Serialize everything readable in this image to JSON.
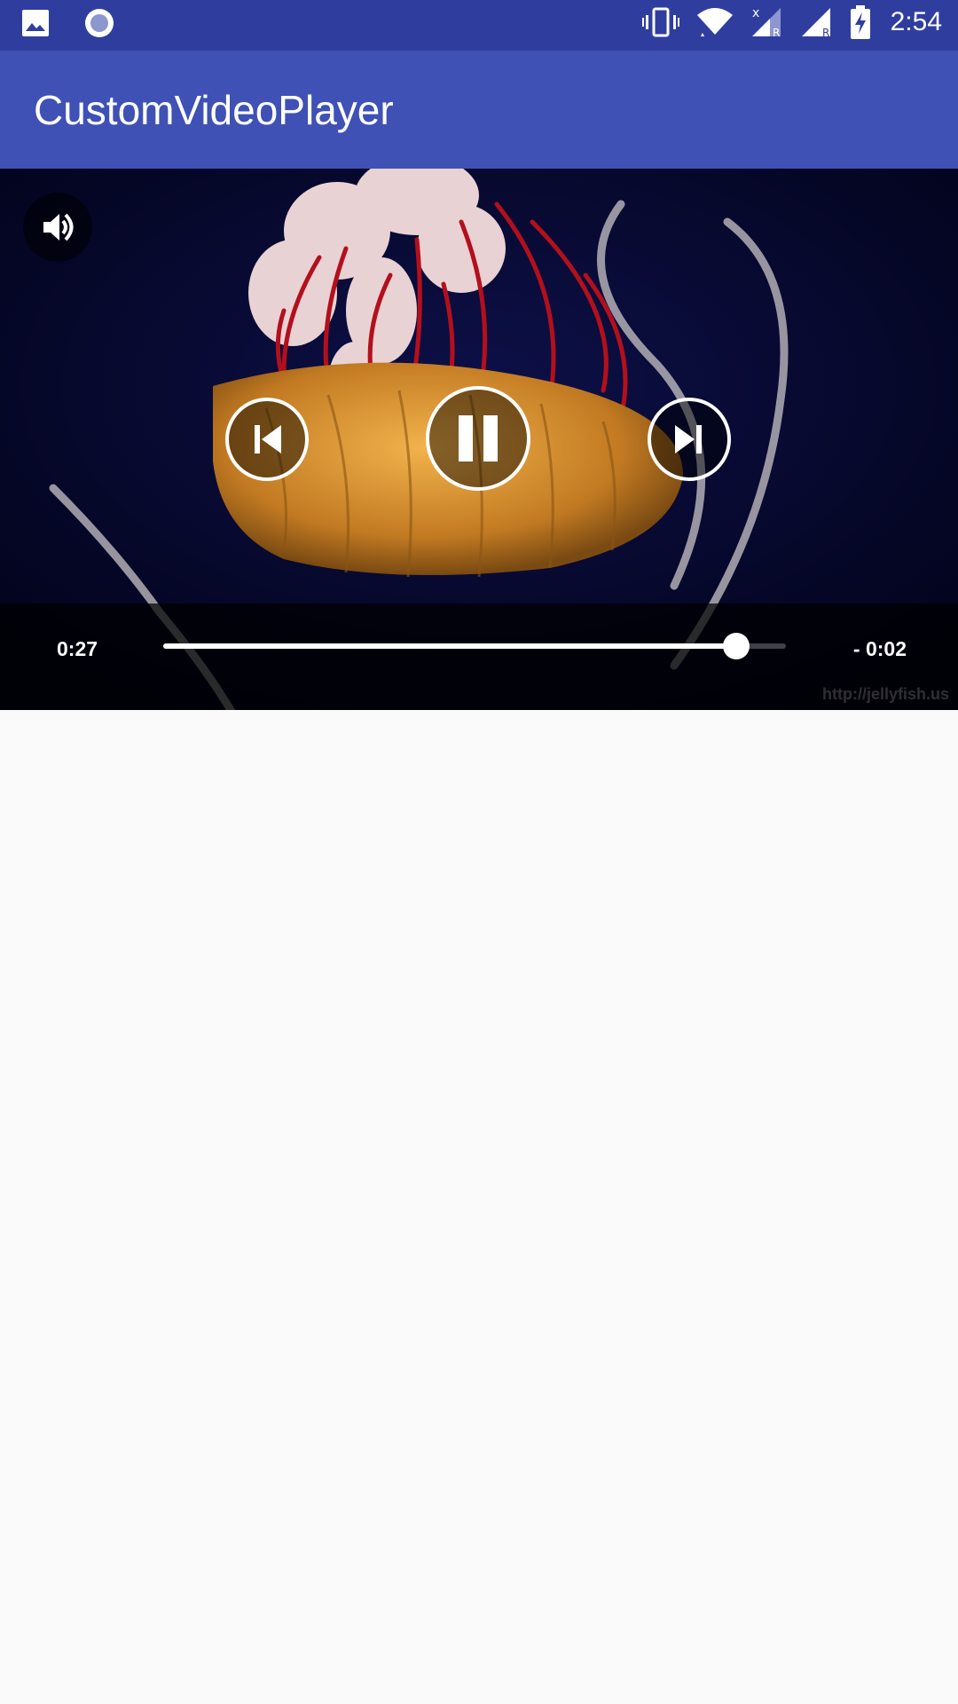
{
  "status_bar": {
    "time": "2:54",
    "left_icons": [
      "image-icon",
      "record-icon"
    ],
    "right_icons": [
      "vibrate-icon",
      "wifi-icon",
      "signal-roaming-icon",
      "signal-roaming-icon",
      "battery-charging-icon"
    ]
  },
  "app_bar": {
    "title": "CustomVideoPlayer"
  },
  "player": {
    "volume_icon": "volume-icon",
    "prev_icon": "skip-previous-icon",
    "pause_icon": "pause-icon",
    "next_icon": "skip-next-icon",
    "elapsed": "0:27",
    "remaining": "- 0:02",
    "progress_fraction": 0.92,
    "watermark": "http://jellyfish.us"
  },
  "colors": {
    "status_bar": "#2f3e9e",
    "app_bar": "#3f51b5",
    "background": "#fafafa"
  }
}
